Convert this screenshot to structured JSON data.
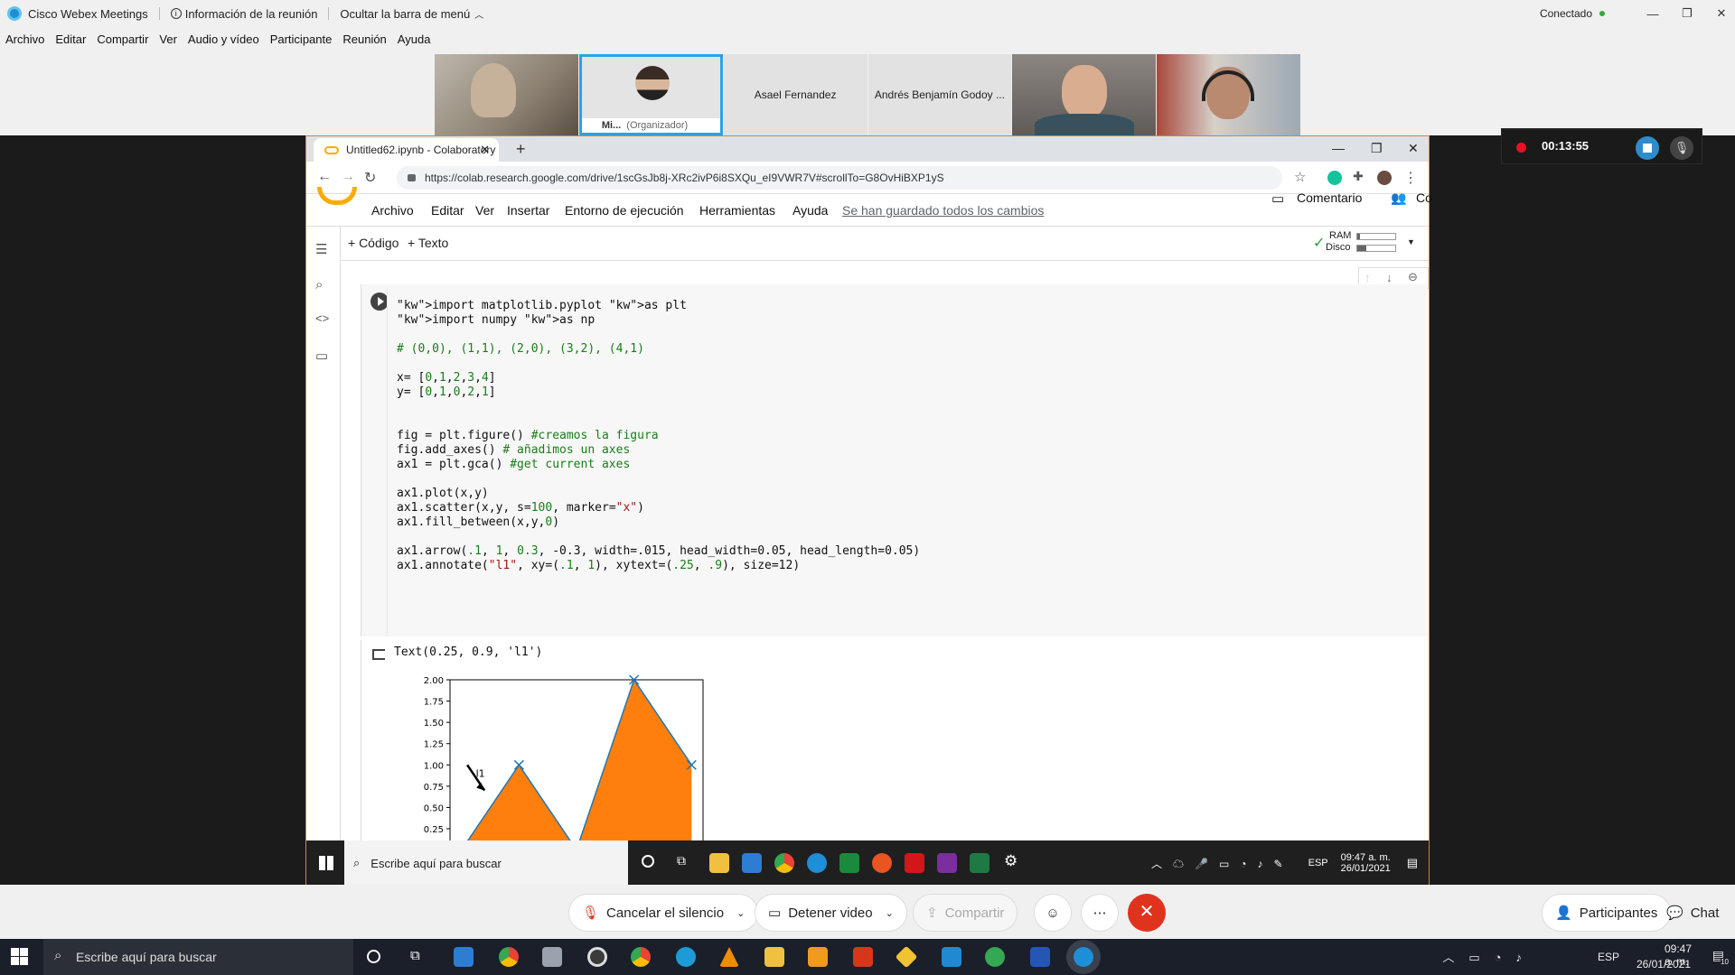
{
  "webex": {
    "app_title": "Cisco Webex Meetings",
    "meeting_info": "Información de la reunión",
    "hide_menu": "Ocultar la barra de menú",
    "status": "Conectado",
    "menu": [
      "Archivo",
      "Editar",
      "Compartir",
      "Ver",
      "Audio y vídeo",
      "Participante",
      "Reunión",
      "Ayuda"
    ],
    "participants": [
      {
        "name": ""
      },
      {
        "name": "Mi...",
        "role": "(Organizador)"
      },
      {
        "name": "Asael Fernandez"
      },
      {
        "name": "Andrés Benjamín Godoy ..."
      },
      {
        "name": ""
      },
      {
        "name": ""
      }
    ],
    "recording_time": "00:13:55",
    "controls": {
      "mute": "Cancelar el silencio",
      "video": "Detener video",
      "share": "Compartir",
      "participants": "Participantes",
      "chat": "Chat"
    }
  },
  "browser": {
    "tab_title": "Untitled62.ipynb - Colaboratory",
    "url": "https://colab.research.google.com/drive/1scGsJb8j-XRc2ivP6i8SXQu_eI9VWR7V#scrollTo=G8OvHiBXP1yS"
  },
  "colab": {
    "menu": [
      "Archivo",
      "Editar",
      "Ver",
      "Insertar",
      "Entorno de ejecución",
      "Herramientas",
      "Ayuda"
    ],
    "saved": "Se han guardado todos los cambios",
    "comment": "Comentario",
    "share_partial": "Co",
    "toolbar": {
      "code": "+ Código",
      "text": "+ Texto",
      "ram": "RAM",
      "disk": "Disco"
    },
    "output_text": "Text(0.25, 0.9, 'l1')"
  },
  "code_lines": [
    "import matplotlib.pyplot as plt",
    "import numpy as np",
    "",
    "# (0,0), (1,1), (2,0), (3,2), (4,1)",
    "",
    "x= [0,1,2,3,4]",
    "y= [0,1,0,2,1]",
    "",
    "",
    "fig = plt.figure() #creamos la figura",
    "fig.add_axes() # añadimos un axes",
    "ax1 = plt.gca() #get current axes",
    "",
    "ax1.plot(x,y)",
    "ax1.scatter(x,y, s=100, marker=\"x\")",
    "ax1.fill_between(x,y,0)",
    "",
    "ax1.arrow(.1, 1, 0.3, -0.3, width=.015, head_width=0.05, head_length=0.05)",
    "ax1.annotate(\"l1\", xy=(.1, 1), xytext=(.25, .9), size=12)"
  ],
  "chart_data": {
    "type": "area",
    "x": [
      0,
      1,
      2,
      3,
      4
    ],
    "values": [
      0,
      1,
      0,
      2,
      1
    ],
    "ylim": [
      0,
      2
    ],
    "yticks": [
      "2.00",
      "1.75",
      "1.50",
      "1.25",
      "1.00",
      "0.75",
      "0.50",
      "0.25"
    ],
    "annotation": "l1",
    "fill_color": "#ff7f0e",
    "line_color": "#1f77b4"
  },
  "inner_taskbar": {
    "search": "Escribe aquí para buscar",
    "lang": "ESP",
    "time": "09:47 a. m.",
    "date": "26/01/2021"
  },
  "win_taskbar": {
    "search": "Escribe aquí para buscar",
    "lang": "ESP",
    "time": "09:47 a. m.",
    "date": "26/01/2021",
    "notif": "10"
  }
}
